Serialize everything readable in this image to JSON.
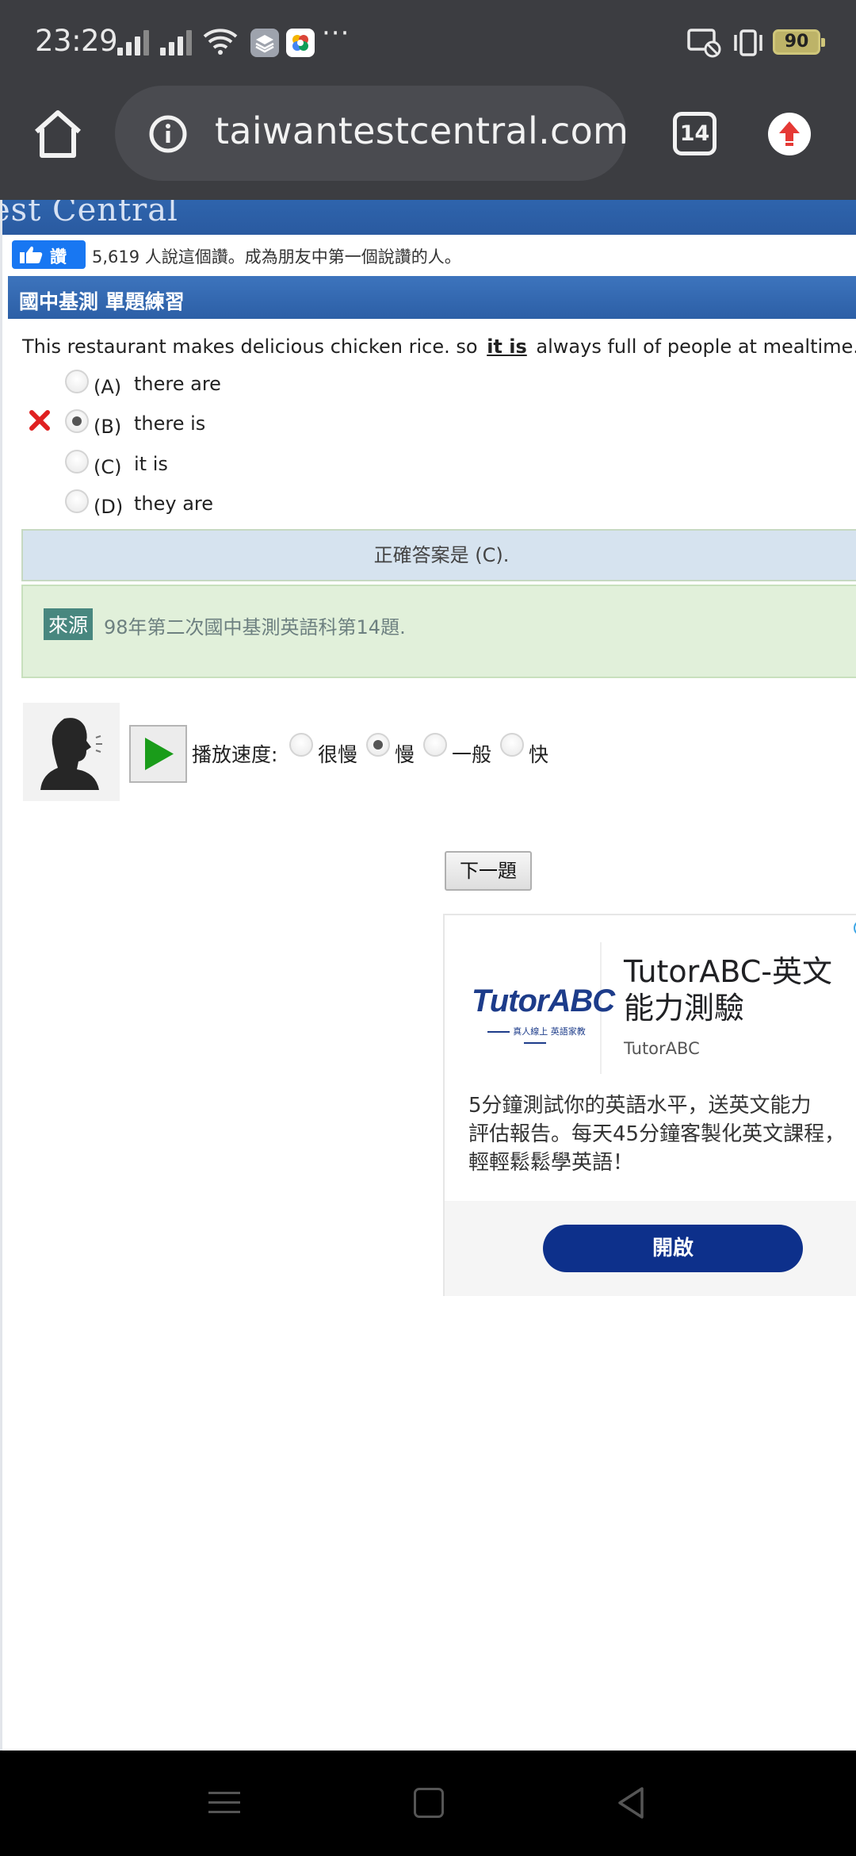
{
  "status_bar": {
    "time": "23:29",
    "more": "···",
    "battery": "90"
  },
  "browser": {
    "url": "taiwantestcentral.com/",
    "tab_count": "14"
  },
  "page": {
    "header_partial_title": "est Central",
    "facebook": {
      "like_label": "讚",
      "like_text": "5,619 人說這個讚。成為朋友中第一個說讚的人。"
    },
    "section_title": "國中基測 單題練習",
    "question": {
      "before": "This restaurant makes delicious chicken rice. so",
      "blank": "it is",
      "after": "always full of people at mealtime."
    },
    "options": [
      {
        "letter": "(A)",
        "text": "there are",
        "selected": false
      },
      {
        "letter": "(B)",
        "text": "there is",
        "selected": true
      },
      {
        "letter": "(C)",
        "text": "it is",
        "selected": false
      },
      {
        "letter": "(D)",
        "text": "they are",
        "selected": false
      }
    ],
    "answer_text": "正確答案是 (C).",
    "source": {
      "tag": "來源",
      "text": "98年第二次國中基測英語科第14題."
    },
    "audio": {
      "speed_label": "播放速度:",
      "speeds": [
        "很慢",
        "慢",
        "一般",
        "快"
      ],
      "selected_speed": "慢"
    },
    "next_button": "下一題"
  },
  "ad": {
    "logo": "TutorABC",
    "logo_sub": "真人線上 英語家教",
    "title": "TutorABC-英文能力測驗",
    "brand": "TutorABC",
    "description_lines": [
      "5分鐘測試你的英語水平，送英文能力",
      "評估報告。每天45分鐘客製化英文課程，",
      "輕輕鬆鬆學英語！"
    ],
    "cta": "開啟"
  },
  "colors": {
    "chrome_bg": "#3c3d41",
    "section_blue": "#2c5fa6",
    "answer_bg": "#d6e3ef",
    "source_bg": "#e1f0da",
    "ad_cta": "#0d308b",
    "wrong_red": "#e02020",
    "play_green": "#1a9c1a"
  }
}
